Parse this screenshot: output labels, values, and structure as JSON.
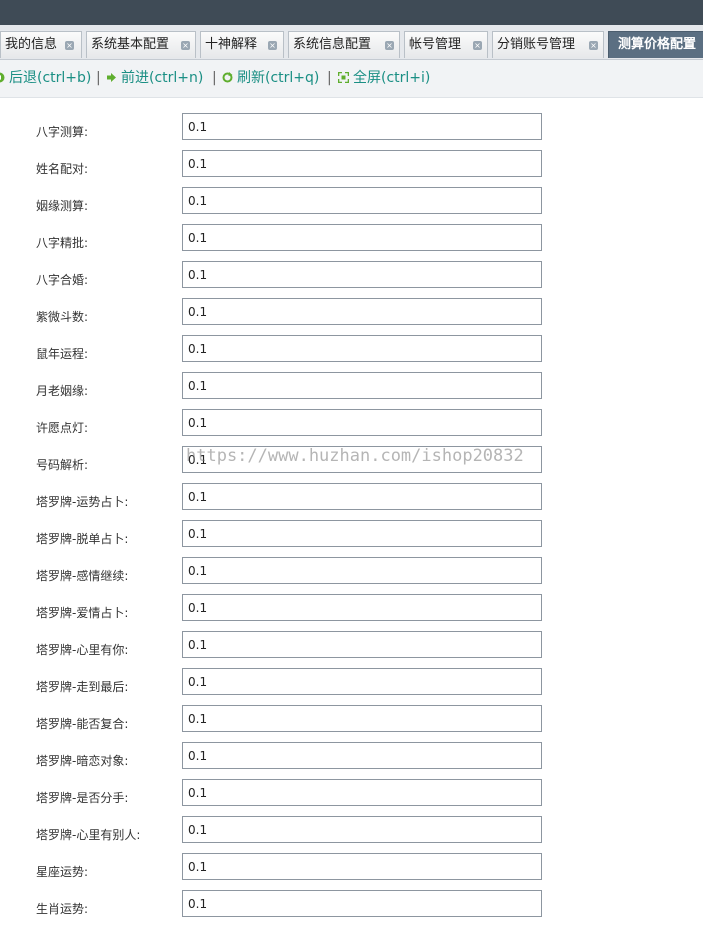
{
  "tabs": [
    {
      "label": "我的信息"
    },
    {
      "label": "系统基本配置"
    },
    {
      "label": "十神解释"
    },
    {
      "label": "系统信息配置"
    },
    {
      "label": "帐号管理"
    },
    {
      "label": "分销账号管理"
    },
    {
      "label": "测算价格配置"
    }
  ],
  "toolbar": {
    "back": "后退(ctrl+b)",
    "forward": "前进(ctrl+n)",
    "refresh": "刷新(ctrl+q)",
    "fullscreen": "全屏(ctrl+i)",
    "separator": "|"
  },
  "fields": [
    {
      "label": "八字测算:",
      "value": "0.1"
    },
    {
      "label": "姓名配对:",
      "value": "0.1"
    },
    {
      "label": "姻缘测算:",
      "value": "0.1"
    },
    {
      "label": "八字精批:",
      "value": "0.1"
    },
    {
      "label": "八字合婚:",
      "value": "0.1"
    },
    {
      "label": "紫微斗数:",
      "value": "0.1"
    },
    {
      "label": "鼠年运程:",
      "value": "0.1"
    },
    {
      "label": "月老姻缘:",
      "value": "0.1"
    },
    {
      "label": "许愿点灯:",
      "value": "0.1"
    },
    {
      "label": "号码解析:",
      "value": "0.1"
    },
    {
      "label": "塔罗牌-运势占卜:",
      "value": "0.1"
    },
    {
      "label": "塔罗牌-脱单占卜:",
      "value": "0.1"
    },
    {
      "label": "塔罗牌-感情继续:",
      "value": "0.1"
    },
    {
      "label": "塔罗牌-爱情占卜:",
      "value": "0.1"
    },
    {
      "label": "塔罗牌-心里有你:",
      "value": "0.1"
    },
    {
      "label": "塔罗牌-走到最后:",
      "value": "0.1"
    },
    {
      "label": "塔罗牌-能否复合:",
      "value": "0.1"
    },
    {
      "label": "塔罗牌-暗恋对象:",
      "value": "0.1"
    },
    {
      "label": "塔罗牌-是否分手:",
      "value": "0.1"
    },
    {
      "label": "塔罗牌-心里有别人:",
      "value": "0.1"
    },
    {
      "label": "星座运势:",
      "value": "0.1"
    },
    {
      "label": "生肖运势:",
      "value": "0.1"
    }
  ],
  "watermark": "https://www.huzhan.com/ishop20832",
  "colors": {
    "toolbar_text": "#1a8f84",
    "active_tab": "#5b6f82",
    "topbar": "#3f4b56"
  }
}
